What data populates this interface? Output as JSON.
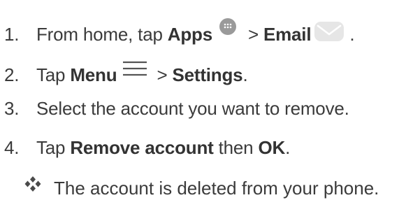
{
  "steps": [
    {
      "num": "1.",
      "pre": "From home, tap ",
      "bold1": "Apps",
      "mid": " > ",
      "bold2": "Email",
      "post": " ."
    },
    {
      "num": "2.",
      "pre": "Tap ",
      "bold1": "Menu",
      "mid": " > ",
      "bold2": "Settings",
      "post": "."
    },
    {
      "num": "3.",
      "text": "Select the account you want to remove."
    },
    {
      "num": "4.",
      "pre": "Tap ",
      "bold1": "Remove account",
      "mid": " then ",
      "bold2": "OK",
      "post": "."
    }
  ],
  "result": {
    "text": "The account is deleted from your phone."
  },
  "icons": {
    "apps": "apps-icon",
    "email": "email-icon",
    "menu": "menu-icon",
    "bullet": "diamond-bullet-icon"
  },
  "colors": {
    "text": "#3b3b3b",
    "icon_gray": "#9a9a9a",
    "email_icon": "#e6e6e6"
  }
}
